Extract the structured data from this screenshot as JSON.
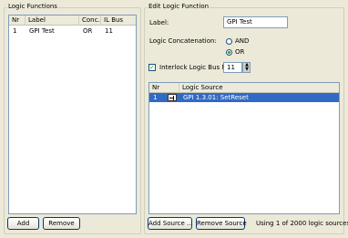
{
  "logic_functions": {
    "title": "Logic Functions",
    "columns": [
      "Nr",
      "Label",
      "Conc.",
      "IL Bus"
    ],
    "rows": [
      {
        "nr": "1",
        "label": "GPI Test",
        "conc": "OR",
        "il_bus": "11"
      }
    ],
    "add_label": "Add",
    "remove_label": "Remove"
  },
  "edit_logic": {
    "title": "Edit Logic Function",
    "label_caption": "Label:",
    "label_value": "GPI Test",
    "concat_caption": "Logic Concatenation:",
    "concat_options": [
      "AND",
      "OR"
    ],
    "concat_selected": "OR",
    "interlock_caption": "Interlock Logic Bus Nr:",
    "interlock_checked": true,
    "interlock_value": "11",
    "sources_columns": [
      "Nr",
      "Logic Source"
    ],
    "sources_rows": [
      {
        "nr": "1",
        "source": "GPI 1.3.01: SetReset"
      }
    ],
    "add_source_label": "Add Source ...",
    "remove_source_label": "Remove Source",
    "usage_text": "Using 1 of 2000 logic sources"
  },
  "colors": {
    "selection": "#316ac5",
    "window_bg": "#ece9d8"
  }
}
